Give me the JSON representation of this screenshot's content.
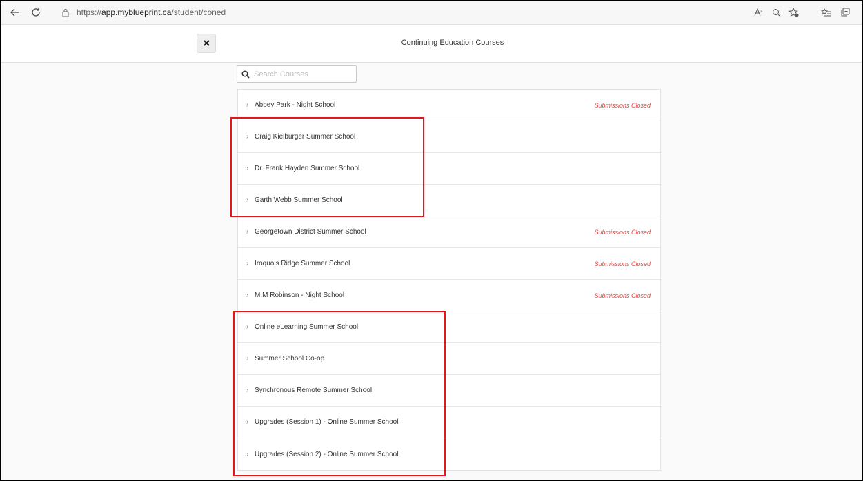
{
  "browser": {
    "url_prefix": "https://",
    "url_host": "app.myblueprint.ca",
    "url_path": "/student/coned",
    "icons": [
      "back-arrow-icon",
      "refresh-icon",
      "lock-icon",
      "read-aloud-icon",
      "zoom-icon",
      "favorite-icon",
      "favorites-list-icon",
      "collections-icon"
    ]
  },
  "header": {
    "title": "Continuing Education Courses",
    "close_icon": "close-icon"
  },
  "search": {
    "placeholder": "Search Courses",
    "icon": "search-icon"
  },
  "courses": [
    {
      "name": "Abbey Park - Night School",
      "status": "Submissions Closed"
    },
    {
      "name": "Craig Kielburger Summer School",
      "status": ""
    },
    {
      "name": "Dr. Frank Hayden Summer School",
      "status": ""
    },
    {
      "name": "Garth Webb Summer School",
      "status": ""
    },
    {
      "name": "Georgetown District Summer School",
      "status": "Submissions Closed"
    },
    {
      "name": "Iroquois Ridge Summer School",
      "status": "Submissions Closed"
    },
    {
      "name": "M.M Robinson - Night School",
      "status": "Submissions Closed"
    },
    {
      "name": "Online eLearning Summer School",
      "status": ""
    },
    {
      "name": "Summer School Co-op",
      "status": ""
    },
    {
      "name": "Synchronous Remote Summer School",
      "status": ""
    },
    {
      "name": "Upgrades (Session 1) - Online Summer School",
      "status": ""
    },
    {
      "name": "Upgrades (Session 2) - Online Summer School",
      "status": ""
    }
  ],
  "colors": {
    "status_closed": "#e8413c",
    "highlight": "#e3161b"
  }
}
